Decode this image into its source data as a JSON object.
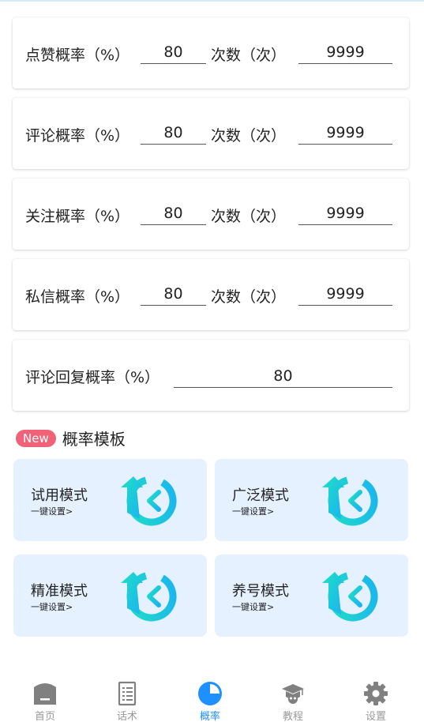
{
  "rows": [
    {
      "label": "点赞概率（%）",
      "prob": "80",
      "count_label": "次数（次）",
      "count": "9999"
    },
    {
      "label": "评论概率（%）",
      "prob": "80",
      "count_label": "次数（次）",
      "count": "9999"
    },
    {
      "label": "关注概率（%）",
      "prob": "80",
      "count_label": "次数（次）",
      "count": "9999"
    },
    {
      "label": "私信概率（%）",
      "prob": "80",
      "count_label": "次数（次）",
      "count": "9999"
    }
  ],
  "reply": {
    "label": "评论回复概率（%）",
    "prob": "80"
  },
  "templates_section": {
    "badge": "New",
    "title": "概率模板"
  },
  "templates": [
    {
      "name": "试用模式",
      "sub": "一键设置>",
      "icon": "refresh-back-icon"
    },
    {
      "name": "广泛模式",
      "sub": "一键设置>",
      "icon": "refresh-back-icon"
    },
    {
      "name": "精准模式",
      "sub": "一键设置>",
      "icon": "refresh-back-icon"
    },
    {
      "name": "养号模式",
      "sub": "一键设置>",
      "icon": "refresh-back-icon"
    }
  ],
  "tabs": [
    {
      "label": "首页",
      "icon": "home-icon",
      "active": false
    },
    {
      "label": "话术",
      "icon": "script-doc-icon",
      "active": false
    },
    {
      "label": "概率",
      "icon": "pie-chart-icon",
      "active": true
    },
    {
      "label": "教程",
      "icon": "graduation-cap-icon",
      "active": false
    },
    {
      "label": "设置",
      "icon": "gear-icon",
      "active": false
    }
  ],
  "colors": {
    "accent": "#1e90ff",
    "badge": "#f06277",
    "template_bg": "#e6f1ff",
    "icon_gradient": [
      "#1fe0c4",
      "#1ab2f2"
    ],
    "tab_inactive": "#999999"
  }
}
